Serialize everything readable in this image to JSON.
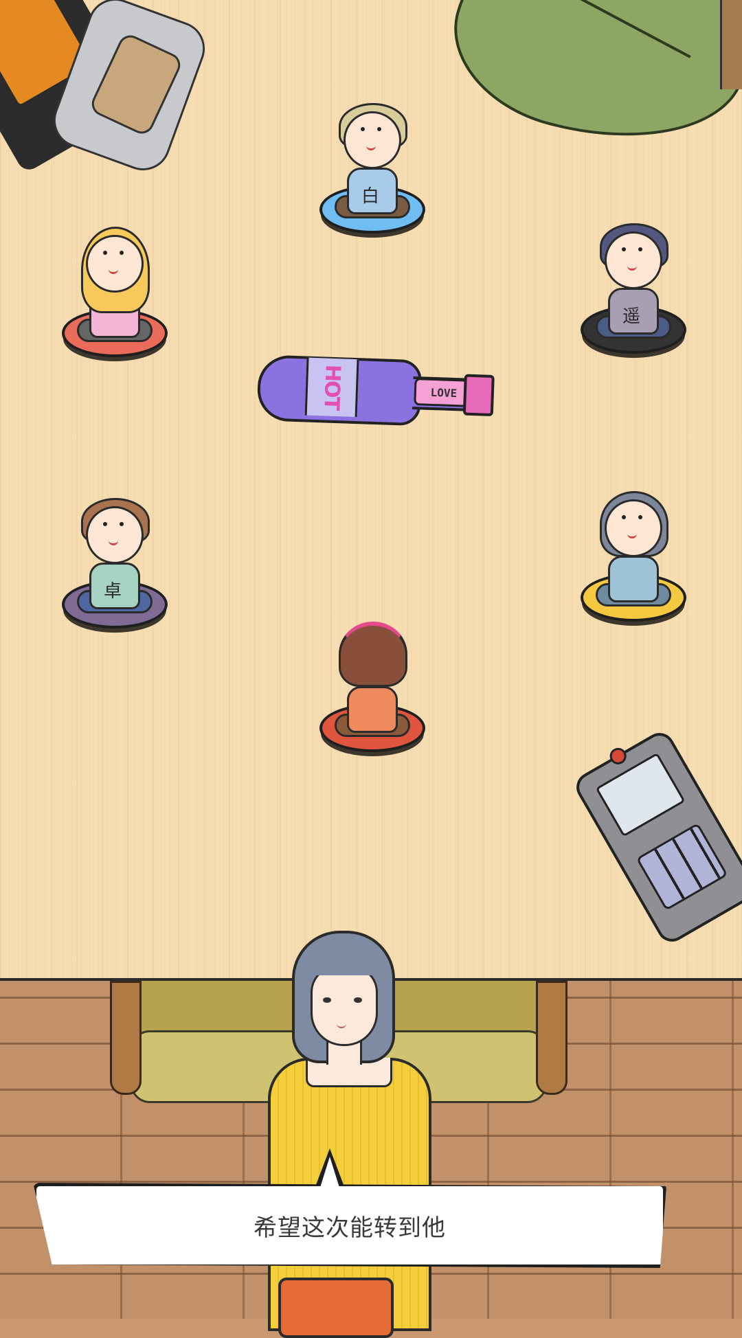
{
  "dialogue": {
    "text": "希望这次能转到他"
  },
  "bottle": {
    "label": "HOT",
    "tag": "LOVE"
  },
  "characters": [
    {
      "name": "glasses-boy",
      "shirt": "白",
      "seat_color": "#6fbdf2",
      "shirt_color": "#a7cbe9",
      "hair_color": "#d8cc9a"
    },
    {
      "name": "blonde-girl",
      "shirt": "",
      "seat_color": "#ec6c5b",
      "shirt_color": "#f4b5d7",
      "hair_color": "#f6c95a"
    },
    {
      "name": "dark-hair-boy",
      "shirt": "遥",
      "seat_color": "#333333",
      "shirt_color": "#a89fb3",
      "hair_color": "#545880"
    },
    {
      "name": "brown-hair-boy",
      "shirt": "卓",
      "seat_color": "#7f6b94",
      "shirt_color": "#a6d2c2",
      "hair_color": "#a8734e"
    },
    {
      "name": "gray-hair-girl",
      "shirt": "",
      "seat_color": "#f4c83f",
      "shirt_color": "#9fc3d6",
      "hair_color": "#7e8799"
    },
    {
      "name": "pink-headband-girl",
      "shirt": "",
      "seat_color": "#e0553d",
      "shirt_color": "#f08b5e",
      "hair_color": "#8a4f3a"
    }
  ],
  "colors": {
    "table": "#f6dcb1",
    "floor": "#c39169",
    "main_top": "#f4cf3b"
  }
}
